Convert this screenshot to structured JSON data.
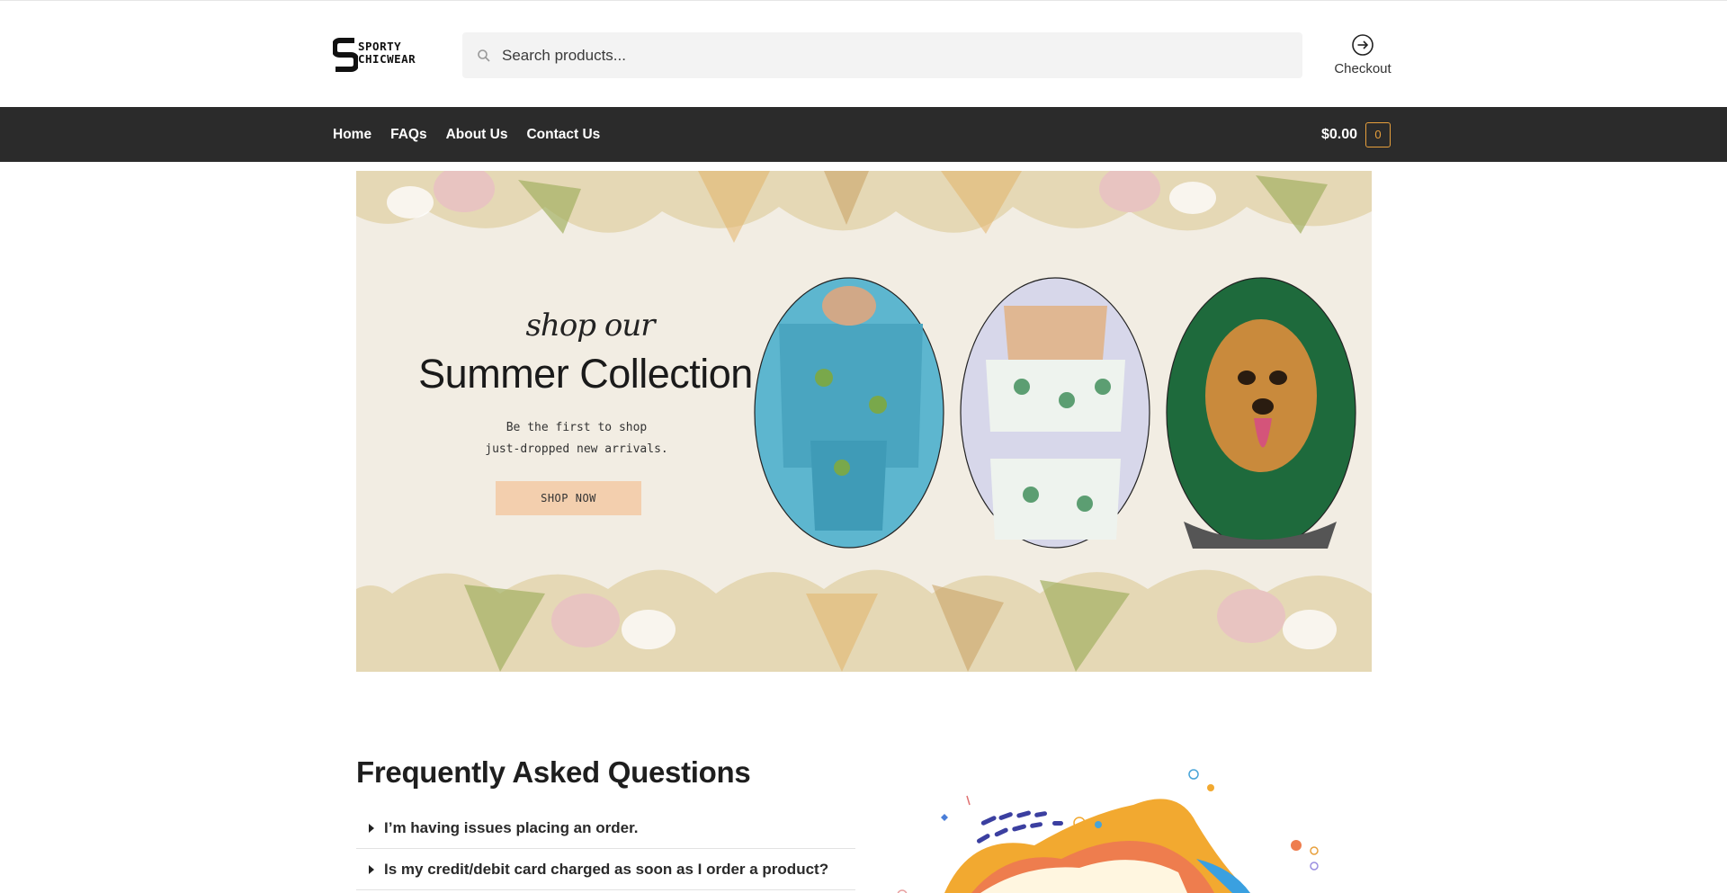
{
  "header": {
    "logo_text_line1": "SPORTY",
    "logo_text_line2": "CHICWEAR",
    "search": {
      "placeholder": "Search products..."
    },
    "checkout_label": "Checkout"
  },
  "nav": {
    "links": [
      {
        "label": "Home"
      },
      {
        "label": "FAQs"
      },
      {
        "label": "About Us"
      },
      {
        "label": "Contact Us"
      }
    ],
    "cart_total": "$0.00",
    "cart_count": "0"
  },
  "banner": {
    "script_text": "shop our",
    "title": "Summer Collection",
    "subtitle": "Be the first to shop\njust-dropped new arrivals.",
    "button_label": "SHOP NOW"
  },
  "faq": {
    "title": "Frequently Asked Questions",
    "items": [
      {
        "question": "I’m having issues placing an order."
      },
      {
        "question": "Is my credit/debit card charged as soon as I order a product?"
      }
    ]
  },
  "colors": {
    "navbar": "#2b2b2b",
    "cart_accent": "#e8a03c",
    "shop_button": "#f3cfae",
    "banner_bg": "#f2ede3"
  }
}
